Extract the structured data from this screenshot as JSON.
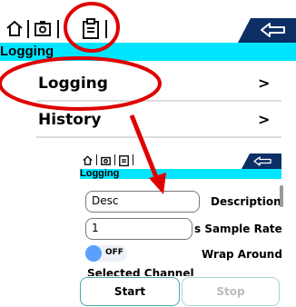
{
  "top_screen": {
    "title": "Logging",
    "menu": [
      {
        "label": "Logging",
        "chevron": ">"
      },
      {
        "label": "History",
        "chevron": ">"
      }
    ],
    "icons": [
      "home-icon",
      "camera-icon",
      "clipboard-icon",
      "back-arrow-icon"
    ]
  },
  "sub_screen": {
    "title": "Logging",
    "description_value": "Desc",
    "description_label": "Description",
    "sample_rate_value": "1",
    "sample_rate_label": "s Sample Rate",
    "wrap_toggle_text": "OFF",
    "wrap_label": "Wrap Around",
    "selected_channel_label": "Selected Channel",
    "start_label": "Start",
    "stop_label": "Stop"
  },
  "colors": {
    "accent_cyan": "#00e5ff",
    "navy": "#0d2f66",
    "annotation_red": "#e00000",
    "toggle_blue": "#5aa0ff"
  }
}
